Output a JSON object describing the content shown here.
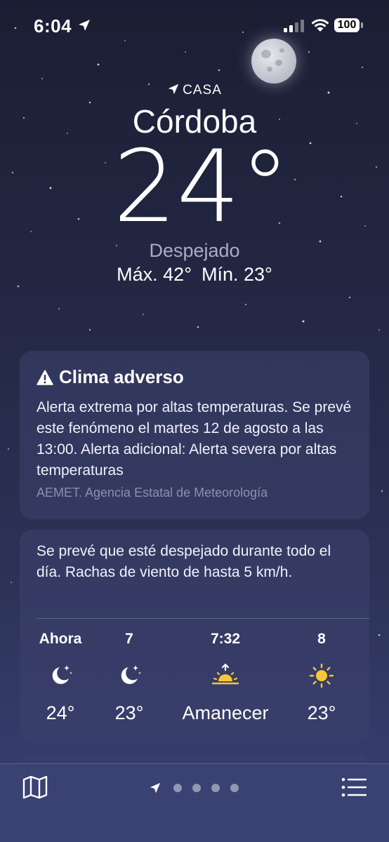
{
  "status_bar": {
    "time": "6:04",
    "battery": "100"
  },
  "location": {
    "tag": "CASA",
    "city": "Córdoba",
    "temperature": "24°",
    "condition": "Despejado",
    "high": "Máx. 42°",
    "low": "Mín. 23°"
  },
  "alert": {
    "title": "Clima adverso",
    "text": "Alerta extrema por altas temperaturas. Se prevé este fenómeno el martes 12 de agosto a las 13:00. Alerta adicional: Alerta severa por altas temperaturas",
    "source": "AEMET. Agencia Estatal de Meteorología"
  },
  "forecast": {
    "summary": "Se prevé que esté despejado durante todo el día. Rachas de viento de hasta 5 km/h.",
    "hours": [
      {
        "label": "Ahora",
        "icon": "moon-stars-icon",
        "value": "24°"
      },
      {
        "label": "7",
        "icon": "moon-stars-icon",
        "value": "23°"
      },
      {
        "label": "7:32",
        "icon": "sunrise-icon",
        "value": "Amanecer"
      },
      {
        "label": "8",
        "icon": "sun-icon",
        "value": "23°"
      }
    ]
  },
  "bottom_bar": {
    "page_count": 4,
    "active_page": "location-arrow"
  },
  "colors": {
    "sun": "#f9c733",
    "condition_text": "#a9adc6"
  }
}
